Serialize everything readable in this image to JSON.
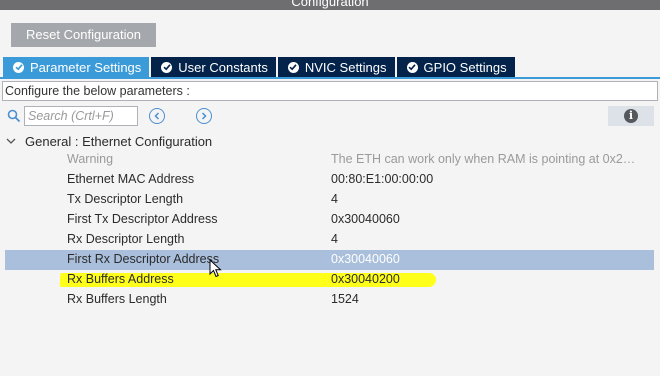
{
  "window": {
    "title": "Configuration"
  },
  "toolbar": {
    "reset_label": "Reset Configuration"
  },
  "tabs": [
    {
      "label": "Parameter Settings",
      "active": true
    },
    {
      "label": "User Constants",
      "active": false
    },
    {
      "label": "NVIC Settings",
      "active": false
    },
    {
      "label": "GPIO Settings",
      "active": false
    }
  ],
  "description": "Configure the below parameters :",
  "search": {
    "placeholder": "Search (Crtl+F)",
    "value": ""
  },
  "group": {
    "label": "General : Ethernet Configuration",
    "expanded": true
  },
  "params": [
    {
      "name": "Warning",
      "value": "The ETH can work only when RAM is pointing at 0x2…",
      "muted": true
    },
    {
      "name": "Ethernet MAC Address",
      "value": "00:80:E1:00:00:00"
    },
    {
      "name": "Tx Descriptor Length",
      "value": "4"
    },
    {
      "name": "First Tx Descriptor Address",
      "value": "0x30040060"
    },
    {
      "name": "Rx Descriptor Length",
      "value": "4"
    },
    {
      "name": "First Rx Descriptor Address",
      "value": "0x30040060",
      "selected": true
    },
    {
      "name": "Rx Buffers Address",
      "value": "0x30040200",
      "highlighted": true
    },
    {
      "name": "Rx Buffers Length",
      "value": "1524"
    }
  ],
  "icons": {
    "search": "search-icon",
    "prev": "arrow-left-icon",
    "next": "arrow-right-icon",
    "info": "info-icon",
    "collapse": "chevron-down-icon",
    "tab_check": "check-circle-icon"
  },
  "colors": {
    "tab_active": "#3b9bd8",
    "tab_inactive": "#03234b",
    "selected_row": "#a9bfdc",
    "highlight": "#ffff1a",
    "reset_button": "#a4a7ab"
  }
}
